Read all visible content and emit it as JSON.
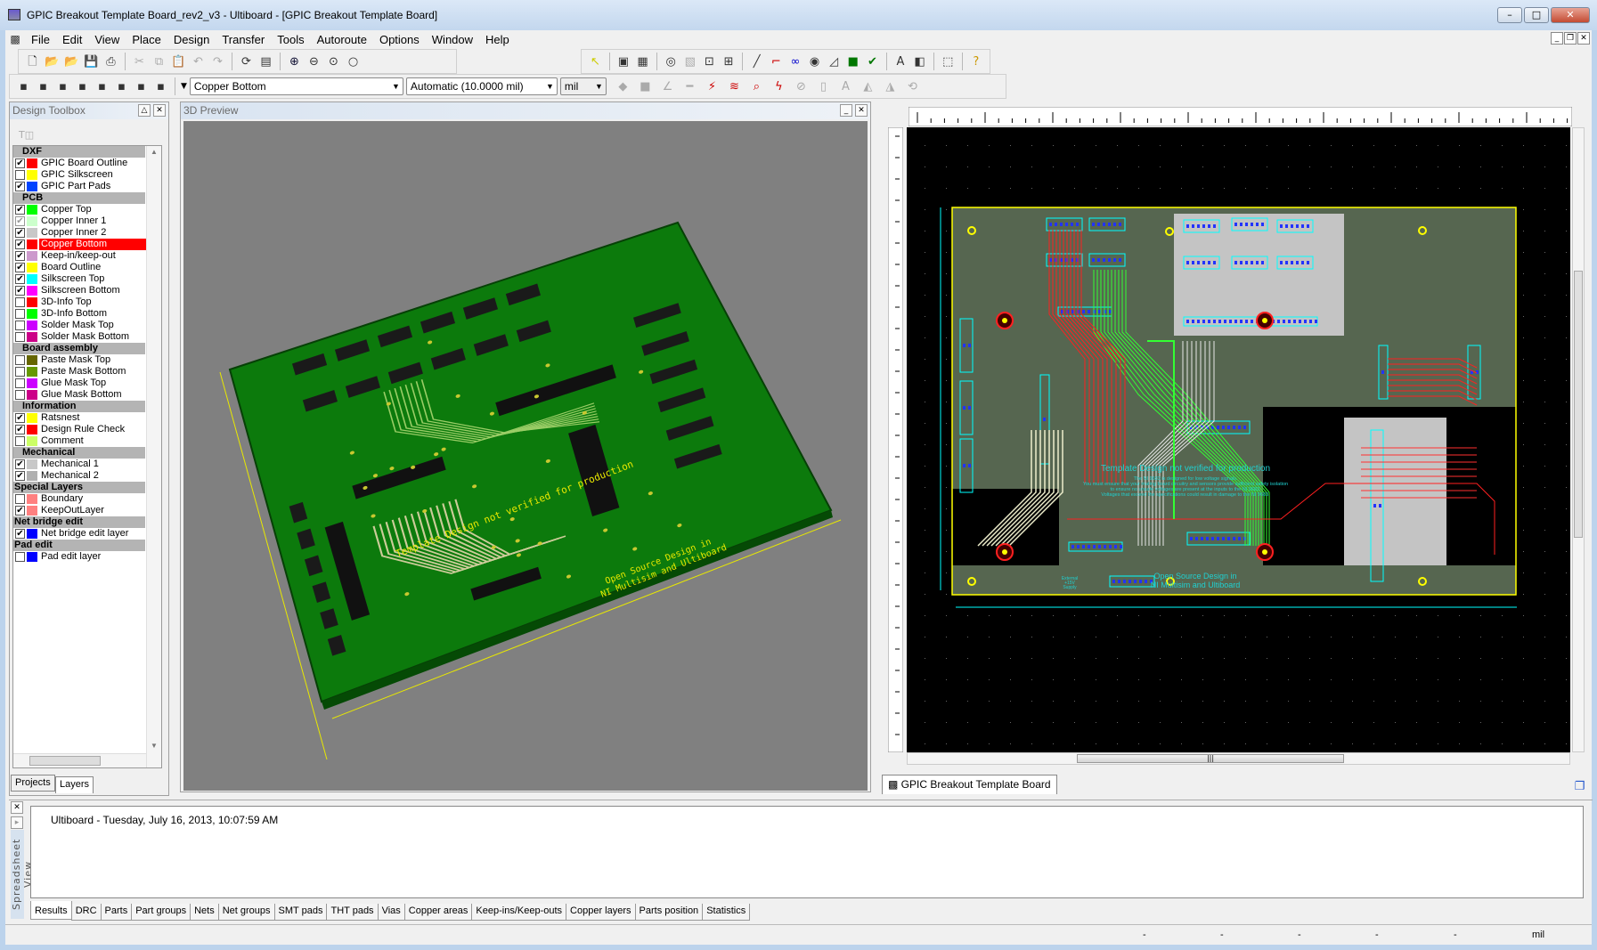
{
  "window": {
    "title": "GPIC Breakout Template Board_rev2_v3 - Ultiboard - [GPIC Breakout Template Board]",
    "controls": [
      "minimize",
      "maximize",
      "close"
    ]
  },
  "menu": [
    "File",
    "Edit",
    "View",
    "Place",
    "Design",
    "Transfer",
    "Tools",
    "Autoroute",
    "Options",
    "Window",
    "Help"
  ],
  "toolbar1": {
    "file_icons": [
      "new-icon",
      "open-icon",
      "open-samples-icon",
      "save-icon",
      "print-icon"
    ],
    "edit_icons": [
      "cut-icon",
      "copy-icon",
      "paste-icon",
      "undo-icon",
      "redo-icon"
    ],
    "view_icons": [
      "refresh-icon",
      "full-screen-icon"
    ],
    "zoom_icons": [
      "zoom-in-icon",
      "zoom-out-icon",
      "zoom-window-icon",
      "zoom-full-icon"
    ],
    "place_icons": [
      "select-icon",
      "group-select-icon",
      "grid-icon",
      "3d-icon",
      "part-icon",
      "pin-swap-icon",
      "net-icon",
      "line-icon",
      "trace-icon",
      "via-icon",
      "jumper-icon",
      "copper-area-icon",
      "copper-fill-icon",
      "drc-icon",
      "text-icon",
      "3d-preview-icon",
      "selection-box-icon",
      "help-icon"
    ]
  },
  "toolbar2": {
    "filter_icons": [
      "filter-parts-icon",
      "filter-traces-icon",
      "filter-shapes-icon",
      "filter-vias-icon",
      "filter-pads-icon",
      "filter-copper-icon",
      "filter-text-icon",
      "filter-other-icon"
    ],
    "layer_select": "Copper Bottom",
    "grid_select": "Automatic (10.0000 mil)",
    "unit_select": "mil",
    "right_icons": [
      "fill-color-icon",
      "fill-pattern-icon",
      "line-style-icon",
      "line-width-icon",
      "autoroute-icon",
      "fanout-icon",
      "inspect-icon",
      "optimize-icon",
      "stop-icon",
      "align-icon",
      "text-size-icon",
      "flip-icon",
      "mirror-icon",
      "rotate-icon"
    ]
  },
  "toolbox": {
    "title": "Design Toolbox",
    "groups": [
      {
        "name": "DXF",
        "full": false,
        "items": [
          {
            "label": "GPIC Board Outline",
            "checked": true,
            "color": "#ff0000"
          },
          {
            "label": "GPIC Silkscreen",
            "checked": false,
            "color": "#ffff00"
          },
          {
            "label": "GPIC Part Pads",
            "checked": true,
            "color": "#0044ff"
          }
        ]
      },
      {
        "name": "PCB",
        "full": false,
        "items": [
          {
            "label": "Copper Top",
            "checked": true,
            "color": "#00ff00"
          },
          {
            "label": "Copper Inner 1",
            "checked": true,
            "grey": true,
            "color": "#ccffcc"
          },
          {
            "label": "Copper Inner 2",
            "checked": true,
            "color": "#c8c8c8"
          },
          {
            "label": "Copper Bottom",
            "checked": true,
            "color": "#ff0000",
            "selected": true
          },
          {
            "label": "Keep-in/keep-out",
            "checked": true,
            "color": "#cc99cc"
          },
          {
            "label": "Board Outline",
            "checked": true,
            "color": "#ffff00"
          },
          {
            "label": "Silkscreen Top",
            "checked": true,
            "color": "#00ffff"
          },
          {
            "label": "Silkscreen Bottom",
            "checked": true,
            "color": "#ff00ff"
          },
          {
            "label": "3D-Info Top",
            "checked": false,
            "color": "#ff0000"
          },
          {
            "label": "3D-Info Bottom",
            "checked": false,
            "color": "#00ff00"
          },
          {
            "label": "Solder Mask Top",
            "checked": false,
            "color": "#cc00ff"
          },
          {
            "label": "Solder Mask Bottom",
            "checked": false,
            "color": "#cc0088"
          }
        ]
      },
      {
        "name": "Board assembly",
        "full": false,
        "items": [
          {
            "label": "Paste Mask Top",
            "checked": false,
            "color": "#666600"
          },
          {
            "label": "Paste Mask Bottom",
            "checked": false,
            "color": "#669900"
          },
          {
            "label": "Glue Mask Top",
            "checked": false,
            "color": "#cc00ff"
          },
          {
            "label": "Glue Mask Bottom",
            "checked": false,
            "color": "#cc0088"
          }
        ]
      },
      {
        "name": "Information",
        "full": false,
        "items": [
          {
            "label": "Ratsnest",
            "checked": true,
            "color": "#ffff00"
          },
          {
            "label": "Design Rule Check",
            "checked": true,
            "color": "#ff0000"
          },
          {
            "label": "Comment",
            "checked": false,
            "color": "#ccff66"
          }
        ]
      },
      {
        "name": "Mechanical",
        "full": false,
        "items": [
          {
            "label": "Mechanical 1",
            "checked": true,
            "color": "#c8c8c8"
          },
          {
            "label": "Mechanical 2",
            "checked": true,
            "color": "#b0b0b0"
          }
        ]
      },
      {
        "name": "Special Layers",
        "full": true,
        "items": [
          {
            "label": "Boundary",
            "checked": false,
            "color": "#ff8080"
          },
          {
            "label": "KeepOutLayer",
            "checked": true,
            "color": "#ff8080"
          }
        ]
      },
      {
        "name": "Net bridge edit",
        "full": true,
        "items": [
          {
            "label": "Net bridge edit layer",
            "checked": true,
            "color": "#0000ff"
          }
        ]
      },
      {
        "name": "Pad edit",
        "full": true,
        "items": [
          {
            "label": "Pad edit layer",
            "checked": false,
            "color": "#0000ff"
          }
        ]
      }
    ],
    "tabs": [
      "Projects",
      "Layers"
    ],
    "active_tab": "Layers"
  },
  "preview3d": {
    "title": "3D Preview",
    "board_text_1": "Template Design not verified for production",
    "board_text_2": "Open Source Design in",
    "board_text_3": "NI Multisim and Ultiboard"
  },
  "layout_view": {
    "doc_tab": "GPIC Breakout Template Board",
    "board_title": "Template Design not verified for production",
    "board_notes": [
      "The NI 9683 is designed for low voltage signals.",
      "You must ensure that your mating board circuitry and sensors provide sufficient safety isolation",
      "to ensure no unsafe voltages are present at the inputs to the NI 9683.",
      "Voltages that exceed the specifications could result in damage to the NI 9683."
    ],
    "footer_1": "Open Source Design in",
    "footer_2": "NI Multisim and Ultiboard",
    "supply_label": [
      "External",
      "+15V",
      "Supply"
    ]
  },
  "spreadsheet": {
    "side_label": "Spreadsheet View",
    "result_line": "Ultiboard  -  Tuesday, July 16, 2013, 10:07:59 AM",
    "tabs": [
      "Results",
      "DRC",
      "Parts",
      "Part groups",
      "Nets",
      "Net groups",
      "SMT pads",
      "THT pads",
      "Vias",
      "Copper areas",
      "Keep-ins/Keep-outs",
      "Copper layers",
      "Parts position",
      "Statistics"
    ],
    "active_tab": "Results"
  },
  "statusbar": {
    "fields": [
      "-",
      "-",
      "-",
      "-",
      "-"
    ],
    "unit": "mil"
  }
}
